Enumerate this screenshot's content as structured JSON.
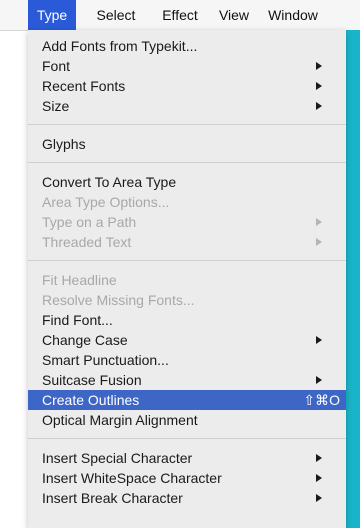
{
  "menubar": {
    "items": [
      "Type",
      "Select",
      "Effect",
      "View",
      "Window"
    ],
    "active": "Type"
  },
  "menu": {
    "items": [
      {
        "label": "Add Fonts from Typekit...",
        "submenu": false,
        "disabled": false
      },
      {
        "label": "Font",
        "submenu": true,
        "disabled": false
      },
      {
        "label": "Recent Fonts",
        "submenu": true,
        "disabled": false
      },
      {
        "label": "Size",
        "submenu": true,
        "disabled": false
      },
      {
        "label": "Glyphs",
        "submenu": false,
        "disabled": false
      },
      {
        "label": "Convert To Area Type",
        "submenu": false,
        "disabled": false
      },
      {
        "label": "Area Type Options...",
        "submenu": false,
        "disabled": true
      },
      {
        "label": "Type on a Path",
        "submenu": true,
        "disabled": true
      },
      {
        "label": "Threaded Text",
        "submenu": true,
        "disabled": true
      },
      {
        "label": "Fit Headline",
        "submenu": false,
        "disabled": true
      },
      {
        "label": "Resolve Missing Fonts...",
        "submenu": false,
        "disabled": true
      },
      {
        "label": "Find Font...",
        "submenu": false,
        "disabled": false
      },
      {
        "label": "Change Case",
        "submenu": true,
        "disabled": false
      },
      {
        "label": "Smart Punctuation...",
        "submenu": false,
        "disabled": false
      },
      {
        "label": "Suitcase Fusion",
        "submenu": true,
        "disabled": false
      },
      {
        "label": "Create Outlines",
        "submenu": false,
        "disabled": false,
        "highlighted": true,
        "shortcut": "⇧⌘O"
      },
      {
        "label": "Optical Margin Alignment",
        "submenu": false,
        "disabled": false
      },
      {
        "label": "Insert Special Character",
        "submenu": true,
        "disabled": false
      },
      {
        "label": "Insert WhiteSpace Character",
        "submenu": true,
        "disabled": false
      },
      {
        "label": "Insert Break Character",
        "submenu": true,
        "disabled": false
      }
    ]
  },
  "colors": {
    "highlight": "#3d66c7",
    "menubar_active": "#2a5ad8",
    "accent_strip": "#1ab4c8",
    "menu_background": "#ececec",
    "disabled_text": "#a8a8a8"
  }
}
